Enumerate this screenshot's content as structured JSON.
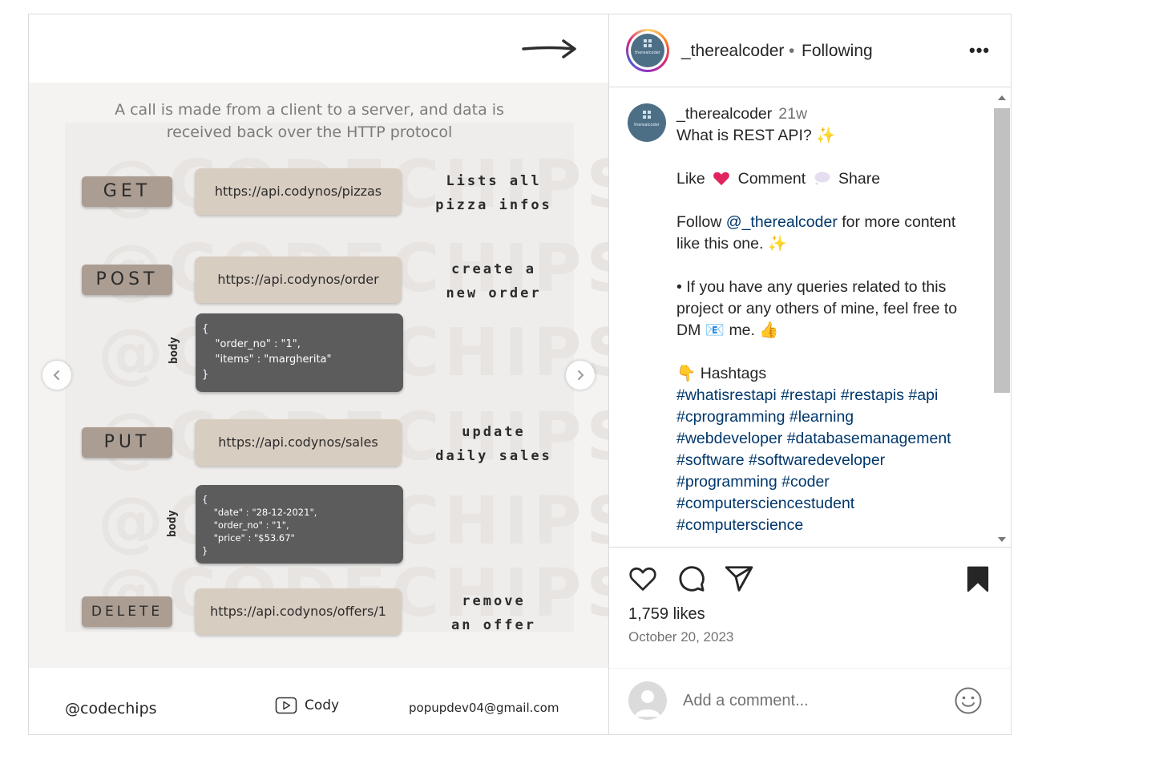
{
  "media": {
    "intro": "A call is made from a client to a server, and data is received back over the HTTP protocol",
    "watermark": "@CODECHIPS",
    "methods": [
      {
        "verb": "GET",
        "url": "https://api.codynos/pizzas",
        "note_line1": "Lists all",
        "note_line2": "pizza infos"
      },
      {
        "verb": "POST",
        "url": "https://api.codynos/order",
        "note_line1": "create a",
        "note_line2": "new order",
        "body_label": "body",
        "body": "{\n    \"order_no\" : \"1\",\n    \"items\" : \"margherita\"\n}"
      },
      {
        "verb": "PUT",
        "url": "https://api.codynos/sales",
        "note_line1": "update",
        "note_line2": "daily sales",
        "body_label": "body",
        "body": "{\n    \"date\" : \"28-12-2021\",\n    \"order_no\" : \"1\",\n    \"price\" : \"$53.67\"\n}"
      },
      {
        "verb": "DELETE",
        "url": "https://api.codynos/offers/1",
        "note_line1": "remove",
        "note_line2": "an offer"
      }
    ],
    "footer": {
      "handle": "@codechips",
      "youtube_name": "Cody",
      "email": "popupdev04@gmail.com"
    },
    "icons": {
      "prev": "chevron-left-icon",
      "next": "chevron-right-icon",
      "youtube": "youtube-play-icon",
      "arrow": "arrow-right-icon"
    }
  },
  "header": {
    "username": "_therealcoder",
    "separator": "•",
    "follow_state": "Following",
    "more": "•••",
    "avatar_text": "therealcoder"
  },
  "caption": {
    "username": "_therealcoder",
    "time_ago": "21w",
    "title": "What is REST API? ✨",
    "cta_like": "Like",
    "cta_comment": "Comment",
    "cta_share": "Share",
    "follow_pre": "Follow ",
    "follow_mention": "@_therealcoder",
    "follow_post": " for more content like this one. ✨",
    "queries": "• If you have any queries related to this project or any others of mine, feel free to DM 📧 me. 👍",
    "hashtags_heading": "👇 Hashtags",
    "hashtags": [
      "#whatisrestapi",
      "#restapi",
      "#restapis",
      "#api",
      "#cprogramming",
      "#learning",
      "#webdeveloper",
      "#databasemanagement",
      "#software",
      "#softwaredeveloper",
      "#programming",
      "#coder",
      "#computersciencestudent",
      "#computerscience"
    ]
  },
  "actions": {
    "likes": "1,759 likes",
    "date": "October 20, 2023",
    "comment_placeholder": "Add a comment...",
    "icons": [
      "heart-icon",
      "comment-icon",
      "share-icon",
      "bookmark-icon",
      "emoji-icon"
    ]
  },
  "colors": {
    "link": "#00376b",
    "method_bg": "#ab9d92",
    "url_bg": "#d8cdc1",
    "body_bg": "#5c5c5c",
    "heart": "#e0245e"
  }
}
